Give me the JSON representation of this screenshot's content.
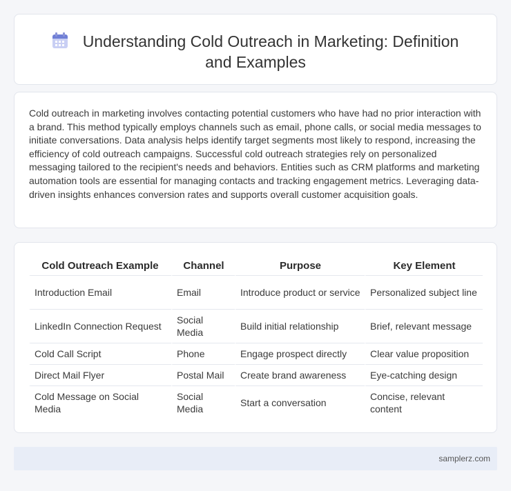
{
  "page": {
    "title": "Understanding Cold Outreach in Marketing: Definition and Examples",
    "title_icon": "calendar-icon"
  },
  "description": "Cold outreach in marketing involves contacting potential customers who have had no prior interaction with a brand. This method typically employs channels such as email, phone calls, or social media messages to initiate conversations. Data analysis helps identify target segments most likely to respond, increasing the efficiency of cold outreach campaigns. Successful cold outreach strategies rely on personalized messaging tailored to the recipient's needs and behaviors. Entities such as CRM platforms and marketing automation tools are essential for managing contacts and tracking engagement metrics. Leveraging data-driven insights enhances conversion rates and supports overall customer acquisition goals.",
  "table": {
    "headers": [
      "Cold Outreach Example",
      "Channel",
      "Purpose",
      "Key Element"
    ],
    "rows": [
      [
        "Introduction Email",
        "Email",
        "Introduce product or service",
        "Personalized subject line"
      ],
      [
        "LinkedIn Connection Request",
        "Social Media",
        "Build initial relationship",
        "Brief, relevant message"
      ],
      [
        "Cold Call Script",
        "Phone",
        "Engage prospect directly",
        "Clear value proposition"
      ],
      [
        "Direct Mail Flyer",
        "Postal Mail",
        "Create brand awareness",
        "Eye-catching design"
      ],
      [
        "Cold Message on Social Media",
        "Social Media",
        "Start a conversation",
        "Concise, relevant content"
      ]
    ]
  },
  "footer": {
    "site": "samplerz.com"
  }
}
